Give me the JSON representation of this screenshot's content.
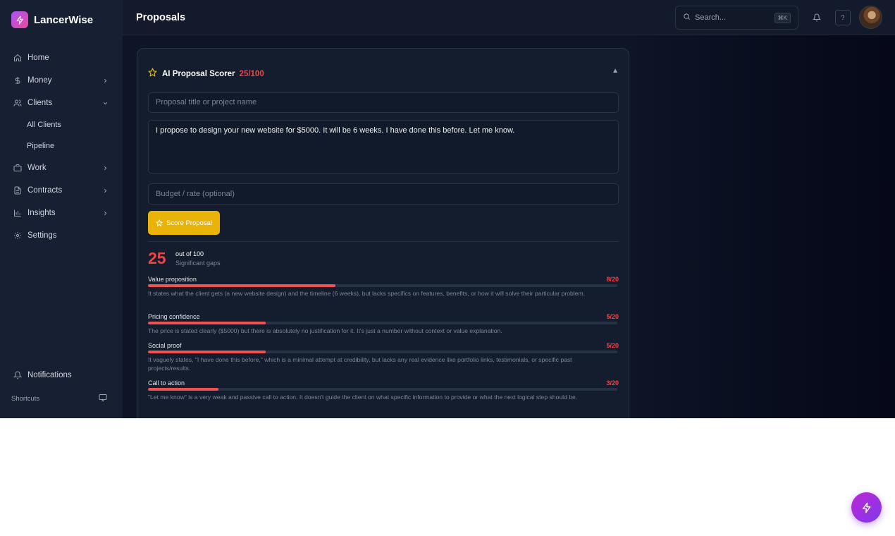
{
  "app": {
    "name": "LancerWise"
  },
  "sidebar": {
    "items": [
      {
        "label": "Home",
        "icon": "home-icon"
      },
      {
        "label": "Money",
        "icon": "dollar-icon",
        "chevron": "right"
      },
      {
        "label": "Clients",
        "icon": "users-icon",
        "chevron": "down"
      },
      {
        "label": "Work",
        "icon": "briefcase-icon",
        "chevron": "right"
      },
      {
        "label": "Contracts",
        "icon": "document-icon",
        "chevron": "right"
      },
      {
        "label": "Insights",
        "icon": "bar-chart-icon",
        "chevron": "right"
      },
      {
        "label": "Settings",
        "icon": "gear-icon"
      }
    ],
    "clients_sub": [
      "All Clients",
      "Pipeline"
    ],
    "notifications": "Notifications",
    "shortcuts": "Shortcuts"
  },
  "header": {
    "title": "Proposals",
    "search_placeholder": "Search...",
    "search_shortcut": "⌘K",
    "help": "?"
  },
  "scorer": {
    "title": "AI Proposal Scorer",
    "score_label": "25/100",
    "title_placeholder": "Proposal title or project name",
    "proposal_text": "I propose to design your new website for $5000. It will be 6 weeks. I have done this before. Let me know.",
    "budget_placeholder": "Budget / rate (optional)",
    "button_label": "Score Proposal",
    "total": "25",
    "out_of": "out of 100",
    "verdict": "Significant gaps",
    "criteria": [
      {
        "name": "Value proposition",
        "score": "8/20",
        "value": 8,
        "max": 20,
        "desc": "It states what the client gets (a new website design) and the timeline (6 weeks), but lacks specifics on features, benefits, or how it will solve their particular problem."
      },
      {
        "name": "Pricing confidence",
        "score": "5/20",
        "value": 5,
        "max": 20,
        "desc": "The price is stated clearly ($5000) but there is absolutely no justification for it. It's just a number without context or value explanation."
      },
      {
        "name": "Social proof",
        "score": "5/20",
        "value": 5,
        "max": 20,
        "desc": "It vaguely states, \"I have done this before,\" which is a minimal attempt at credibility, but lacks any real evidence like portfolio links, testimonials, or specific past projects/results."
      },
      {
        "name": "Call to action",
        "score": "3/20",
        "value": 3,
        "max": 20,
        "desc": "\"Let me know\" is a very weak and passive call to action. It doesn't guide the client on what specific information to provide or what the next logical step should be."
      }
    ]
  },
  "colors": {
    "accent": "#eab308",
    "danger": "#ef4444",
    "brand": "#a855f7"
  }
}
